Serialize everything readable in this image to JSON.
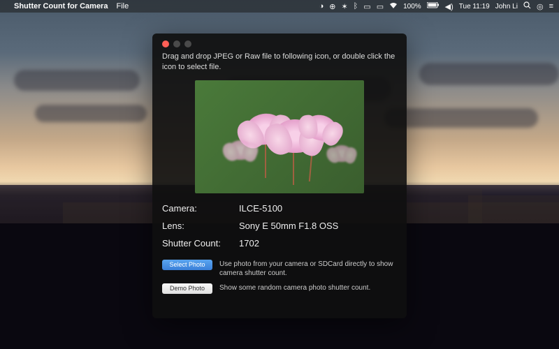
{
  "menubar": {
    "app_name": "Shutter Count for Camera",
    "menus": [
      "File"
    ],
    "status": {
      "battery_text": "100%",
      "day_time": "Tue 11:19",
      "user": "John Li"
    }
  },
  "window": {
    "instruction": "Drag and drop JPEG or Raw file to following icon, or double click the icon to select file.",
    "info": {
      "camera_label": "Camera:",
      "camera_value": "ILCE-5100",
      "lens_label": "Lens:",
      "lens_value": "Sony E 50mm F1.8 OSS",
      "shutter_label": "Shutter Count:",
      "shutter_value": "1702"
    },
    "actions": {
      "select_photo_label": "Select Photo",
      "select_photo_desc": "Use photo from your camera or SDCard directly to show camera shutter count.",
      "demo_photo_label": "Demo Photo",
      "demo_photo_desc": "Show some random camera photo shutter count."
    }
  }
}
